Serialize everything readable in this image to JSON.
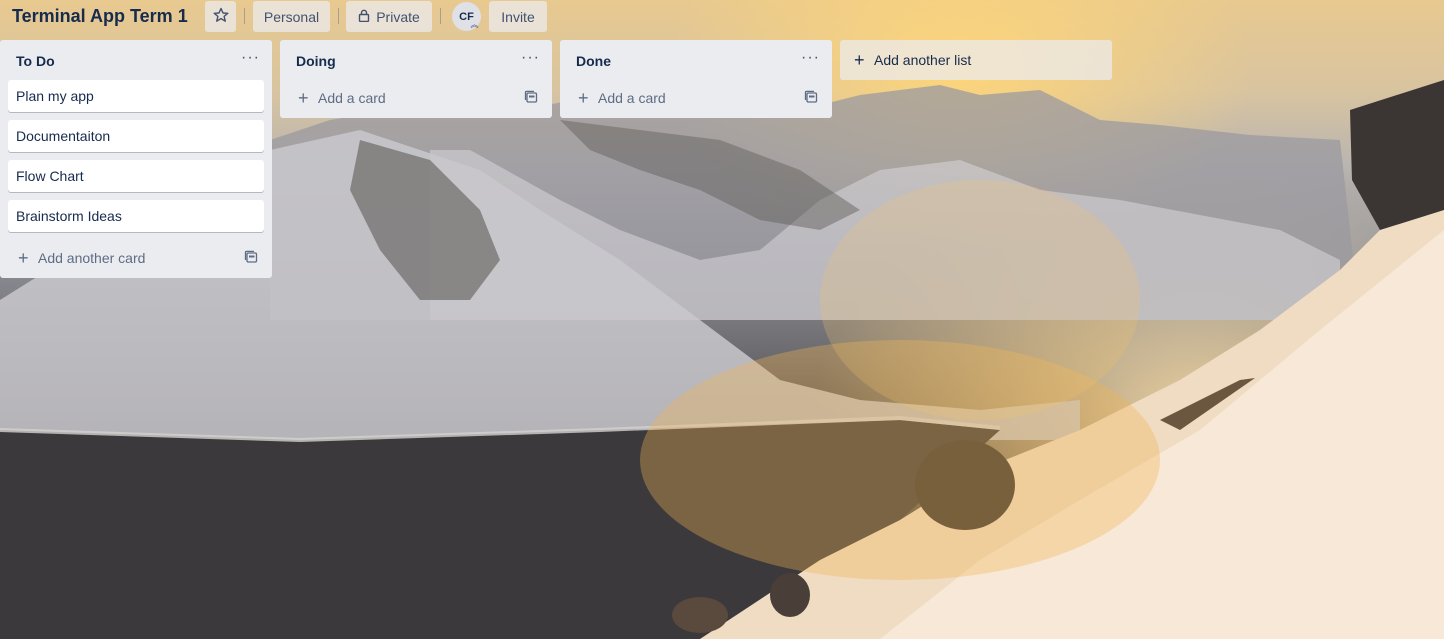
{
  "board": {
    "title": "Terminal App Term 1",
    "personal_label": "Personal",
    "private_label": "Private",
    "avatar_initials": "CF",
    "invite_label": "Invite"
  },
  "lists": [
    {
      "title": "To Do",
      "menu": "···",
      "cards": [
        "Plan my app",
        "Documentaiton",
        "Flow Chart",
        "Brainstorm Ideas"
      ],
      "add_label": "Add another card"
    },
    {
      "title": "Doing",
      "menu": "···",
      "cards": [],
      "add_label": "Add a card"
    },
    {
      "title": "Done",
      "menu": "···",
      "cards": [],
      "add_label": "Add a card"
    }
  ],
  "add_list_label": "Add another list",
  "icons": {
    "star": "star-icon",
    "lock": "lock-icon",
    "plus": "plus-icon",
    "template": "card-template-icon",
    "menu": "more-horizontal-icon"
  },
  "colors": {
    "list_bg": "#ebecf0",
    "card_bg": "#ffffff",
    "text": "#172b4d",
    "muted": "#5e6c84"
  }
}
